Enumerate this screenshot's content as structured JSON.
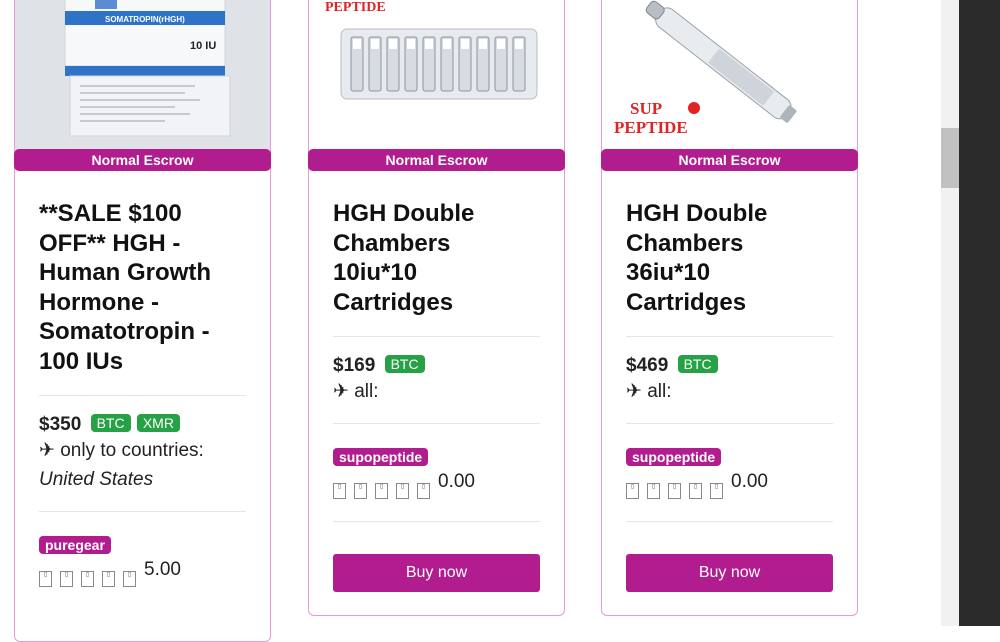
{
  "products": [
    {
      "escrow": "Normal Escrow",
      "title": "**SALE $100 OFF** HGH - Human Growth Hormone - Somatotropin - 100 IUs",
      "price": "$350",
      "currencies": [
        "BTC",
        "XMR"
      ],
      "ship_icon": "plane-icon",
      "ship_text": "only to countries:",
      "countries": "United States",
      "vendor": "puregear",
      "rating": "5.00",
      "image_text": {
        "label": "SOMATROPIN(rHGH)",
        "dose": "10 IU"
      }
    },
    {
      "escrow": "Normal Escrow",
      "title": "HGH Double Chambers 10iu*10 Cartridges",
      "price": "$169",
      "currencies": [
        "BTC"
      ],
      "ship_icon": "plane-icon",
      "ship_text": "all:",
      "vendor": "supopeptide",
      "rating": "0.00",
      "buy_label": "Buy now",
      "image_text": {
        "brand": "PEPTIDE"
      }
    },
    {
      "escrow": "Normal Escrow",
      "title": "HGH Double Chambers 36iu*10 Cartridges",
      "price": "$469",
      "currencies": [
        "BTC"
      ],
      "ship_icon": "plane-icon",
      "ship_text": "all:",
      "vendor": "supopeptide",
      "rating": "0.00",
      "buy_label": "Buy now",
      "image_text": {
        "brand_top": "SUP",
        "brand_bottom": "PEPTIDE"
      }
    }
  ],
  "colors": {
    "accent": "#b11d8f",
    "crypto_badge": "#27a145",
    "card_border": "#e39ad9"
  }
}
